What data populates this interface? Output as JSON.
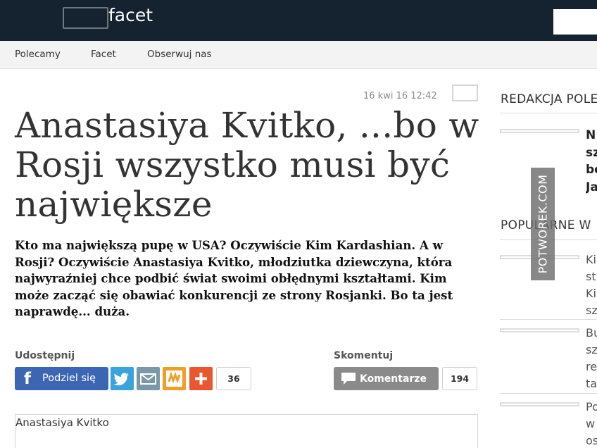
{
  "header": {
    "logo_text": "facet"
  },
  "nav": {
    "items": [
      "Polecamy",
      "Facet",
      "Obserwuj nas"
    ]
  },
  "article": {
    "date": "16 kwi 16 12:42",
    "title": "Anastasiya Kvitko, ...bo w Rosji wszystko musi być największe",
    "lead": "Kto ma największą pupę w USA? Oczywiście Kim Kardashian. A w Rosji? Oczywiście Anastasiya Kvitko, młodziutka dziewczyna, która najwyraźniej chce podbić świat swoimi obłędnymi kształtami. Kim może zacząć się obawiać konkurencji ze strony Rosjanki. Bo ta jest naprawdę... duża.",
    "caption": "Anastasiya Kvitko"
  },
  "share": {
    "label": "Udostępnij",
    "facebook_label": "Podziel się",
    "count": "36",
    "icons": [
      "facebook-icon",
      "twitter-icon",
      "mail-icon",
      "wykop-icon",
      "plus-icon"
    ],
    "colors": {
      "facebook": "#3c66b4",
      "twitter": "#3aa2dc",
      "mail": "#7a98a7",
      "wykop": "#f09e26",
      "plus": "#e8572f"
    }
  },
  "comments": {
    "label": "Skomentuj",
    "button_label": "Komentarze",
    "count": "194"
  },
  "sidebar": {
    "heading_1": "REDAKCJA POLECA",
    "heading_2": "POPULARNE W",
    "featured_lines": [
      "N",
      "sz",
      "be",
      "Ja"
    ],
    "popular": [
      {
        "lines": [
          "Kie",
          "st",
          "Kie",
          "sz"
        ]
      },
      {
        "lines": [
          "Bu",
          "sz",
          "re",
          "ta"
        ]
      },
      {
        "lines": [
          "Po",
          "w",
          "os"
        ]
      }
    ]
  },
  "watermark": "POTWOREK.COM",
  "colors": {
    "topbar": "#14232f",
    "nav_bg": "#f3f3f3"
  }
}
